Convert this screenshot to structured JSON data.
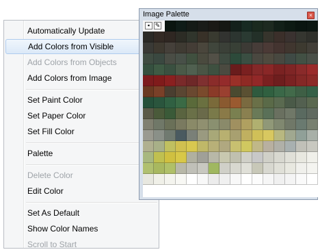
{
  "menu": {
    "items": [
      {
        "label": "Automatically Update",
        "disabled": false
      },
      {
        "label": "Add Colors from Visible",
        "disabled": false,
        "hover": true
      },
      {
        "label": "Add Colors from Objects",
        "disabled": true
      },
      {
        "label": "Add Colors from Image",
        "disabled": false
      },
      {
        "sep": true
      },
      {
        "label": "Set Paint Color",
        "disabled": false
      },
      {
        "label": "Set Paper Color",
        "disabled": false
      },
      {
        "label": "Set Fill Color",
        "disabled": false
      },
      {
        "sep": true
      },
      {
        "label": "Palette",
        "disabled": false
      },
      {
        "sep": true
      },
      {
        "label": "Delete Color",
        "disabled": true
      },
      {
        "label": "Edit Color",
        "disabled": false
      },
      {
        "sep": true
      },
      {
        "label": "Set As Default",
        "disabled": false
      },
      {
        "label": "Show Color Names",
        "disabled": false
      },
      {
        "label": "Scroll to Start",
        "disabled": true
      }
    ]
  },
  "palette_window": {
    "title": "Image Palette",
    "close_icon": "close-icon",
    "tools": [
      "square-tool-icon",
      "eyedropper-icon"
    ],
    "rows": [
      [
        "#0f1a16",
        "#0c1812",
        "#0a1510",
        "#0f1c18",
        "#151b17",
        "#1a1c19",
        "#1b1916",
        "#161814",
        "#14211b",
        "#172a22",
        "#1a2a1e",
        "#1d2a20",
        "#122018",
        "#0d1a13",
        "#0a1510",
        "#0c1712"
      ],
      [
        "#2b2a26",
        "#332a24",
        "#2f2722",
        "#2c2c25",
        "#30352c",
        "#383128",
        "#393a30",
        "#323330",
        "#2c3530",
        "#2a3a32",
        "#233028",
        "#36342c",
        "#3b2f2a",
        "#3a3230",
        "#353630",
        "#2f302b"
      ],
      [
        "#3a3a36",
        "#3e3930",
        "#45403a",
        "#3f3b33",
        "#443d36",
        "#4a463c",
        "#40463c",
        "#3b4038",
        "#384036",
        "#3c3a35",
        "#463c38",
        "#4b3a36",
        "#443430",
        "#40362f",
        "#3d3a30",
        "#423f38"
      ],
      [
        "#3f4c42",
        "#3a4840",
        "#4a4d45",
        "#485048",
        "#40503f",
        "#4a4a3e",
        "#525047",
        "#3e4a40",
        "#2c4a3a",
        "#3a4e42",
        "#4a4840",
        "#4f4a3f",
        "#484840",
        "#3f4a45",
        "#425044",
        "#4a5048"
      ],
      [
        "#35503f",
        "#3e5a44",
        "#3a5040",
        "#4a5a48",
        "#506050",
        "#4a5545",
        "#3e5040",
        "#4b4a40",
        "#691c1c",
        "#7a2020",
        "#842828",
        "#8a2727",
        "#7a2222",
        "#7f2525",
        "#8a2a2a",
        "#9a2b2b"
      ],
      [
        "#7c1c1e",
        "#801b1b",
        "#8a2020",
        "#7a2a2a",
        "#6e2828",
        "#7f3030",
        "#8a2c2a",
        "#942b2b",
        "#9a3028",
        "#8f2a24",
        "#922828",
        "#7b2020",
        "#6e1e1e",
        "#7a2222",
        "#842826",
        "#8c2a28"
      ],
      [
        "#6a3a22",
        "#7a4028",
        "#4a3e30",
        "#5a4632",
        "#6a4830",
        "#7a4a2c",
        "#8a3a28",
        "#9a4030",
        "#4a4a30",
        "#5a5032",
        "#2f5a3e",
        "#306040",
        "#3a6848",
        "#426a4a",
        "#3e5f45",
        "#356047"
      ],
      [
        "#25503a",
        "#2a553d",
        "#306042",
        "#3a6a45",
        "#5a6a3a",
        "#6a7040",
        "#7a6a3a",
        "#8a5a30",
        "#9a5a30",
        "#7a6a40",
        "#6a7048",
        "#5a6a48",
        "#5a6a50",
        "#4a5a48",
        "#536050",
        "#5a6850"
      ],
      [
        "#5a5a48",
        "#4a5a3a",
        "#3a5a38",
        "#5a6440",
        "#6a7048",
        "#6a6a4a",
        "#7a7a4a",
        "#8a7a48",
        "#7a8050",
        "#8a8050",
        "#6a7a58",
        "#5a7058",
        "#6a7060",
        "#707868",
        "#5a6a60",
        "#606a60"
      ],
      [
        "#808070",
        "#707868",
        "#6a7058",
        "#7a7a60",
        "#8a8a68",
        "#909070",
        "#8a9070",
        "#8a8a6a",
        "#a09060",
        "#b0a060",
        "#b0b070",
        "#909878",
        "#808870",
        "#707868",
        "#6a7a70",
        "#788070"
      ],
      [
        "#9a9a90",
        "#8a9088",
        "#707a70",
        "#4a5a60",
        "#7a8078",
        "#9a9a80",
        "#a8a878",
        "#b8b070",
        "#a8a070",
        "#c0b060",
        "#d0c058",
        "#d8c860",
        "#b8b880",
        "#a0a890",
        "#90a098",
        "#a8b0a8"
      ],
      [
        "#b0b090",
        "#a8b088",
        "#c0c060",
        "#d0c050",
        "#d8c850",
        "#c0b868",
        "#b8b078",
        "#b0a880",
        "#c8c070",
        "#d0c860",
        "#c0b888",
        "#b8b0a0",
        "#b0b0a8",
        "#a8b0b0",
        "#c0c0b8",
        "#c8c8c0"
      ],
      [
        "#a8b880",
        "#c0c050",
        "#d0c040",
        "#d8c848",
        "#b0b0a0",
        "#a0a098",
        "#b8b8a8",
        "#c8c8b0",
        "#c0c0b0",
        "#d0d0c8",
        "#c8c8c8",
        "#d0d0c8",
        "#d8d8d0",
        "#e0e0d8",
        "#e8e8e0",
        "#f0f0ea"
      ],
      [
        "#b0c070",
        "#a8b860",
        "#b0c068",
        "#b8b8a8",
        "#c0c0b8",
        "#c8c8c0",
        "#a0b860",
        "#d0d0c8",
        "#d8d8d0",
        "#e0e0d8",
        "#c8c8b8",
        "#d8d8d0",
        "#e0e0d8",
        "#e8e8e0",
        "#f0f0ec",
        "#f4f4f0"
      ],
      [
        "#e8e8e0",
        "#f0f0e8",
        "#f4f4ee",
        "#f8f8f4",
        "#ffffff",
        "#f8f8f8",
        "#ececec",
        "#f0f0f0",
        "#f8f8f8",
        "#ffffff",
        "#fcfcfc",
        "#f6f6f6",
        "#f0f0f0",
        "#f4f4f4",
        "#fafafa",
        "#ffffff"
      ]
    ]
  }
}
